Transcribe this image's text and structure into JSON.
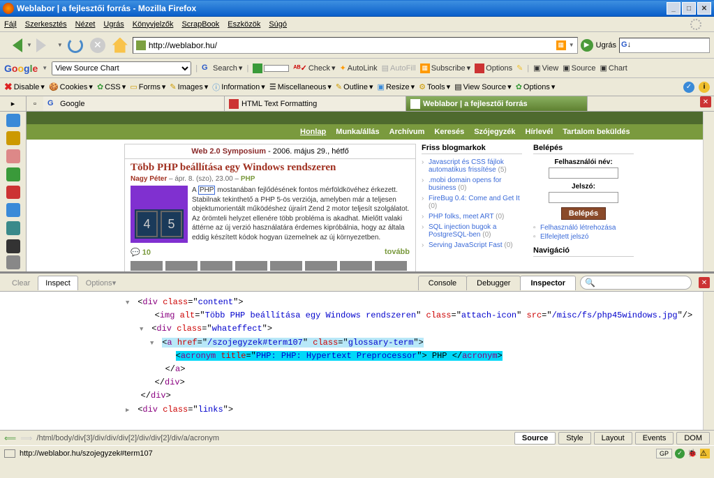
{
  "window": {
    "title": "Weblabor | a fejlesztői forrás - Mozilla Firefox"
  },
  "menubar": [
    "Fájl",
    "Szerkesztés",
    "Nézet",
    "Ugrás",
    "Könyvjelzők",
    "ScrapBook",
    "Eszközök",
    "Súgó"
  ],
  "url": "http://weblabor.hu/",
  "go_label": "Ugrás",
  "google_toolbar": {
    "searchbox": "View Source Chart",
    "items": [
      "Search",
      "PageRank",
      "Check",
      "AutoLink",
      "AutoFill",
      "Subscribe",
      "Options",
      "View",
      "Source",
      "Chart"
    ]
  },
  "webdev": [
    "Disable",
    "Cookies",
    "CSS",
    "Forms",
    "Images",
    "Information",
    "Miscellaneous",
    "Outline",
    "Resize",
    "Tools",
    "View Source",
    "Options"
  ],
  "tabs": [
    {
      "label": "Google"
    },
    {
      "label": "HTML Text Formatting"
    },
    {
      "label": "Weblabor | a fejlesztői forrás"
    }
  ],
  "weblabor": {
    "nav": [
      "Honlap",
      "Munka/állás",
      "Archívum",
      "Keresés",
      "Szójegyzék",
      "Hírlevél",
      "Tartalom beküldés"
    ],
    "symposium": {
      "title": "Web 2.0 Symposium",
      "date": " - 2006. május 29., hétfő"
    },
    "article": {
      "title": "Több PHP beállítása egy Windows rendszeren",
      "author": "Nagy Péter",
      "date": " – ápr. 8. (szo), 23.00 – ",
      "cat": "PHP",
      "php_hl": "PHP",
      "body_before": "A ",
      "body_after": " mostanában fejlődésének fontos mérföldkövéhez érkezett. Stabilnak tekinthető a PHP 5-ös verziója, amelyben már a teljesen objektumorientált működéshez újraírt Zend 2 motor teljesít szolgálatot. Az örömteli helyzet ellenére több probléma is akadhat. Mielőtt valaki áttérne az új verzió használatára érdemes kipróbálnia, hogy az általa eddig készített kódok hogyan üzemelnek az új környezetben.",
      "comments": "10",
      "more": "tovább"
    },
    "blogmarks": {
      "title": "Friss blogmarkok",
      "items": [
        {
          "t": "Javascript és CSS fájlok automatikus frissítése",
          "c": "(5)"
        },
        {
          "t": ".mobi domain opens for business",
          "c": "(0)"
        },
        {
          "t": "FireBug 0.4: Come and Get It",
          "c": "(0)"
        },
        {
          "t": "PHP folks, meet ART",
          "c": "(0)"
        },
        {
          "t": "SQL injection bugok a PostgreSQL-ben",
          "c": "(0)"
        },
        {
          "t": "Serving JavaScript Fast",
          "c": "(0)"
        }
      ]
    },
    "login": {
      "title": "Belépés",
      "user": "Felhasználói név:",
      "pass": "Jelszó:",
      "submit": "Belépés",
      "links": [
        "Felhasználó létrehozása",
        "Elfelejtett jelszó"
      ],
      "nav": "Navigáció"
    }
  },
  "firebug": {
    "left_tabs": [
      "Clear",
      "Inspect",
      "Options"
    ],
    "right_tabs": [
      "Console",
      "Debugger",
      "Inspector"
    ],
    "source": [
      "<div class=\"content\">",
      "<img alt=\"Több PHP beállítása egy Windows rendszeren\" class=\"attach-icon\" src=\"/misc/fs/php45windows.jpg\"/>",
      "<div class=\"whateffect\">",
      "<a href=\"/szojegyzek#term107\" class=\"glossary-term\">",
      "<acronym title=\"PHP: PHP: Hypertext Preprocessor\"> PHP </acronym>",
      "</a>",
      "</div>",
      "</div>",
      "<div class=\"links\">"
    ],
    "path": "/html/body/div[3]/div/div/div[2]/div/div[2]/div/a/acronym",
    "status_btns": [
      "Source",
      "Style",
      "Layout",
      "Events",
      "DOM"
    ]
  },
  "statusbar": {
    "text": "http://weblabor.hu/szojegyzek#term107",
    "gp": "GP"
  }
}
